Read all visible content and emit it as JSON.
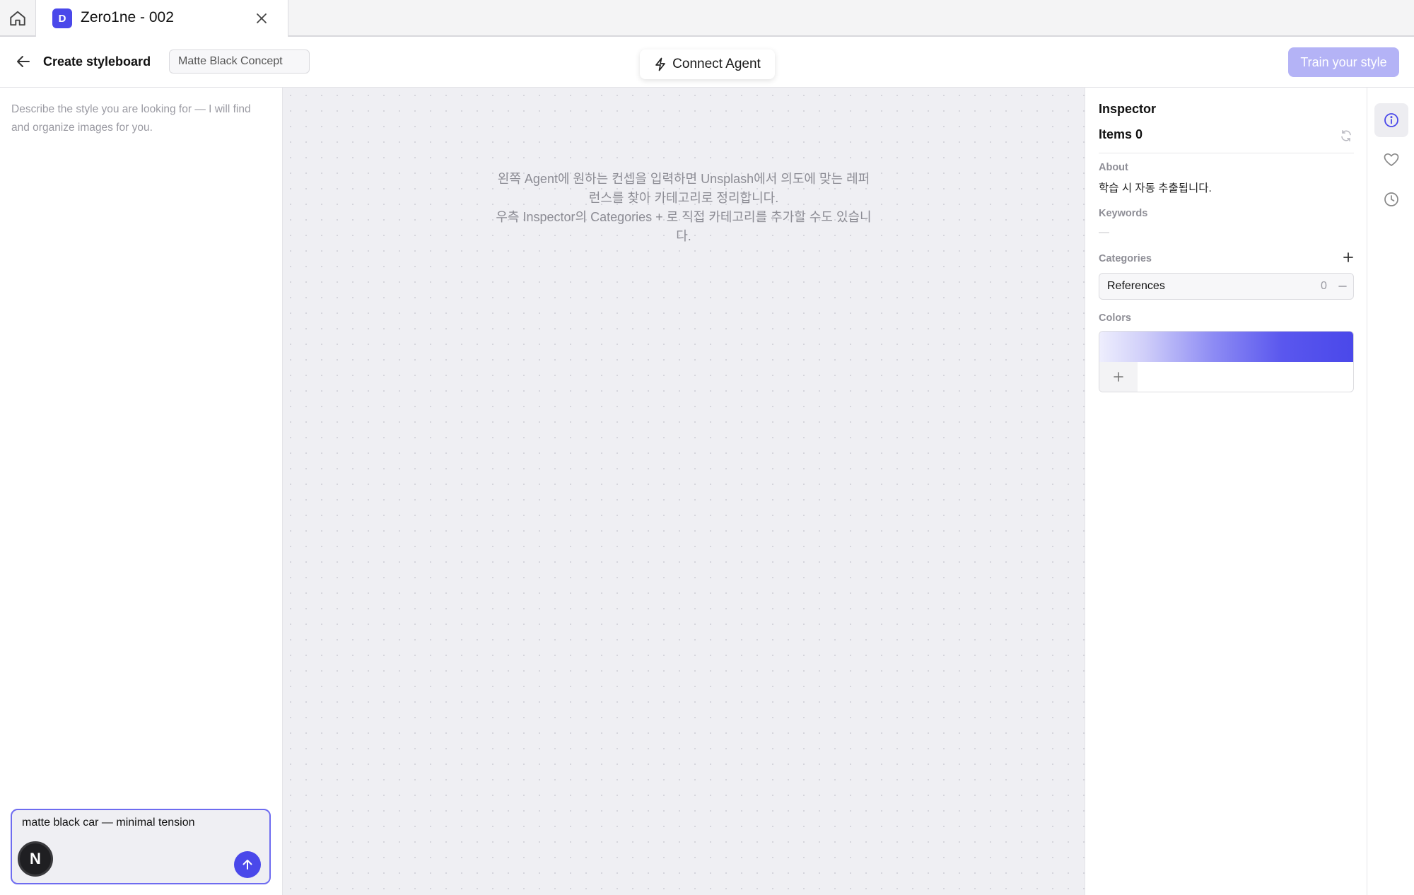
{
  "tab": {
    "badge": "D",
    "title": "Zero1ne - 002"
  },
  "header": {
    "title": "Create styleboard",
    "board_name": "Matte Black Concept",
    "connect_label": "Connect Agent",
    "train_label": "Train your style"
  },
  "left_panel": {
    "hint": "Describe the style you are looking for — I will find and organize images for you.",
    "chat_input": "matte black car — minimal tension",
    "avatar_letter": "N"
  },
  "canvas": {
    "message_line1": "왼쪽 Agent에 원하는 컨셉을 입력하면 Unsplash에서 의도에 맞는 레퍼런스를 찾아 카테고리로 정리합니다.",
    "message_line2": "우측 Inspector의 Categories + 로 직접 카테고리를 추가할 수도 있습니다."
  },
  "inspector": {
    "title": "Inspector",
    "items_label": "Items 0",
    "about_label": "About",
    "about_text": "학습 시 자동 추출됩니다.",
    "keywords_label": "Keywords",
    "keywords_value": "—",
    "categories_label": "Categories",
    "categories": [
      {
        "name": "References",
        "count": "0"
      }
    ],
    "colors_label": "Colors"
  },
  "icons": {
    "home": "home-icon",
    "close": "close-icon",
    "back": "arrow-left-icon",
    "connect": "lightning-icon",
    "send": "arrow-up-icon",
    "refresh": "refresh-icon",
    "add": "plus-icon",
    "remove": "minus-icon",
    "info": "info-icon",
    "favorites": "heart-icon",
    "history": "clock-icon"
  },
  "colors": {
    "accent": "#4a48ea",
    "train_button": "#b4b3f6",
    "canvas_bg": "#efeff3",
    "palette_gradient": [
      "#eeeefd",
      "#cfcef9",
      "#8d8bf4",
      "#5a57ee",
      "#4a48ea"
    ]
  }
}
